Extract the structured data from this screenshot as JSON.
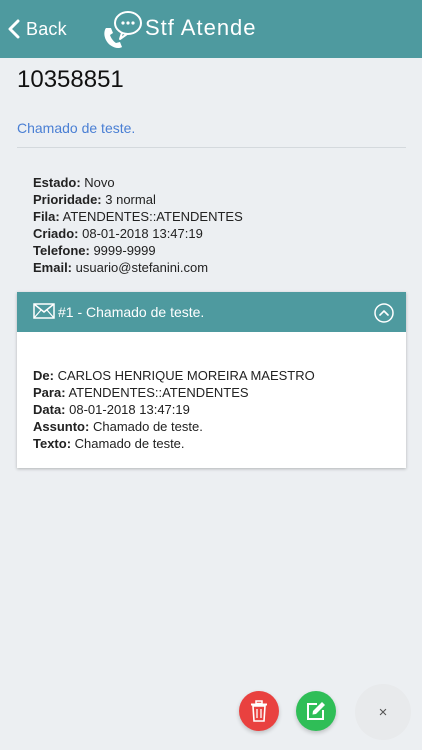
{
  "header": {
    "back_label": "Back",
    "app_title": "Stf Atende",
    "background_color": "#4e9a9f"
  },
  "ticket": {
    "number": "10358851",
    "subject": "Chamado de teste.",
    "details": [
      {
        "label": "Estado:",
        "value": "Novo"
      },
      {
        "label": "Prioridade:",
        "value": "3 normal"
      },
      {
        "label": "Fila:",
        "value": "ATENDENTES::ATENDENTES"
      },
      {
        "label": "Criado:",
        "value": "08-01-2018 13:47:19"
      },
      {
        "label": "Telefone:",
        "value": "9999-9999"
      },
      {
        "label": "Email:",
        "value": "usuario@stefanini.com"
      }
    ]
  },
  "article": {
    "title": "#1 - Chamado de teste.",
    "icon": "envelope-icon",
    "fields": [
      {
        "label": "De:",
        "value": "CARLOS HENRIQUE MOREIRA MAESTRO"
      },
      {
        "label": "Para:",
        "value": "ATENDENTES::ATENDENTES"
      },
      {
        "label": "Data:",
        "value": "08-01-2018 13:47:19"
      },
      {
        "label": "Assunto:",
        "value": "Chamado de teste."
      },
      {
        "label": "Texto:",
        "value": "Chamado de teste."
      }
    ]
  },
  "actions": {
    "delete_icon": "trash-icon",
    "edit_icon": "edit-icon",
    "close_label": "×",
    "delete_color": "#e9413f",
    "edit_color": "#2fbe57"
  }
}
